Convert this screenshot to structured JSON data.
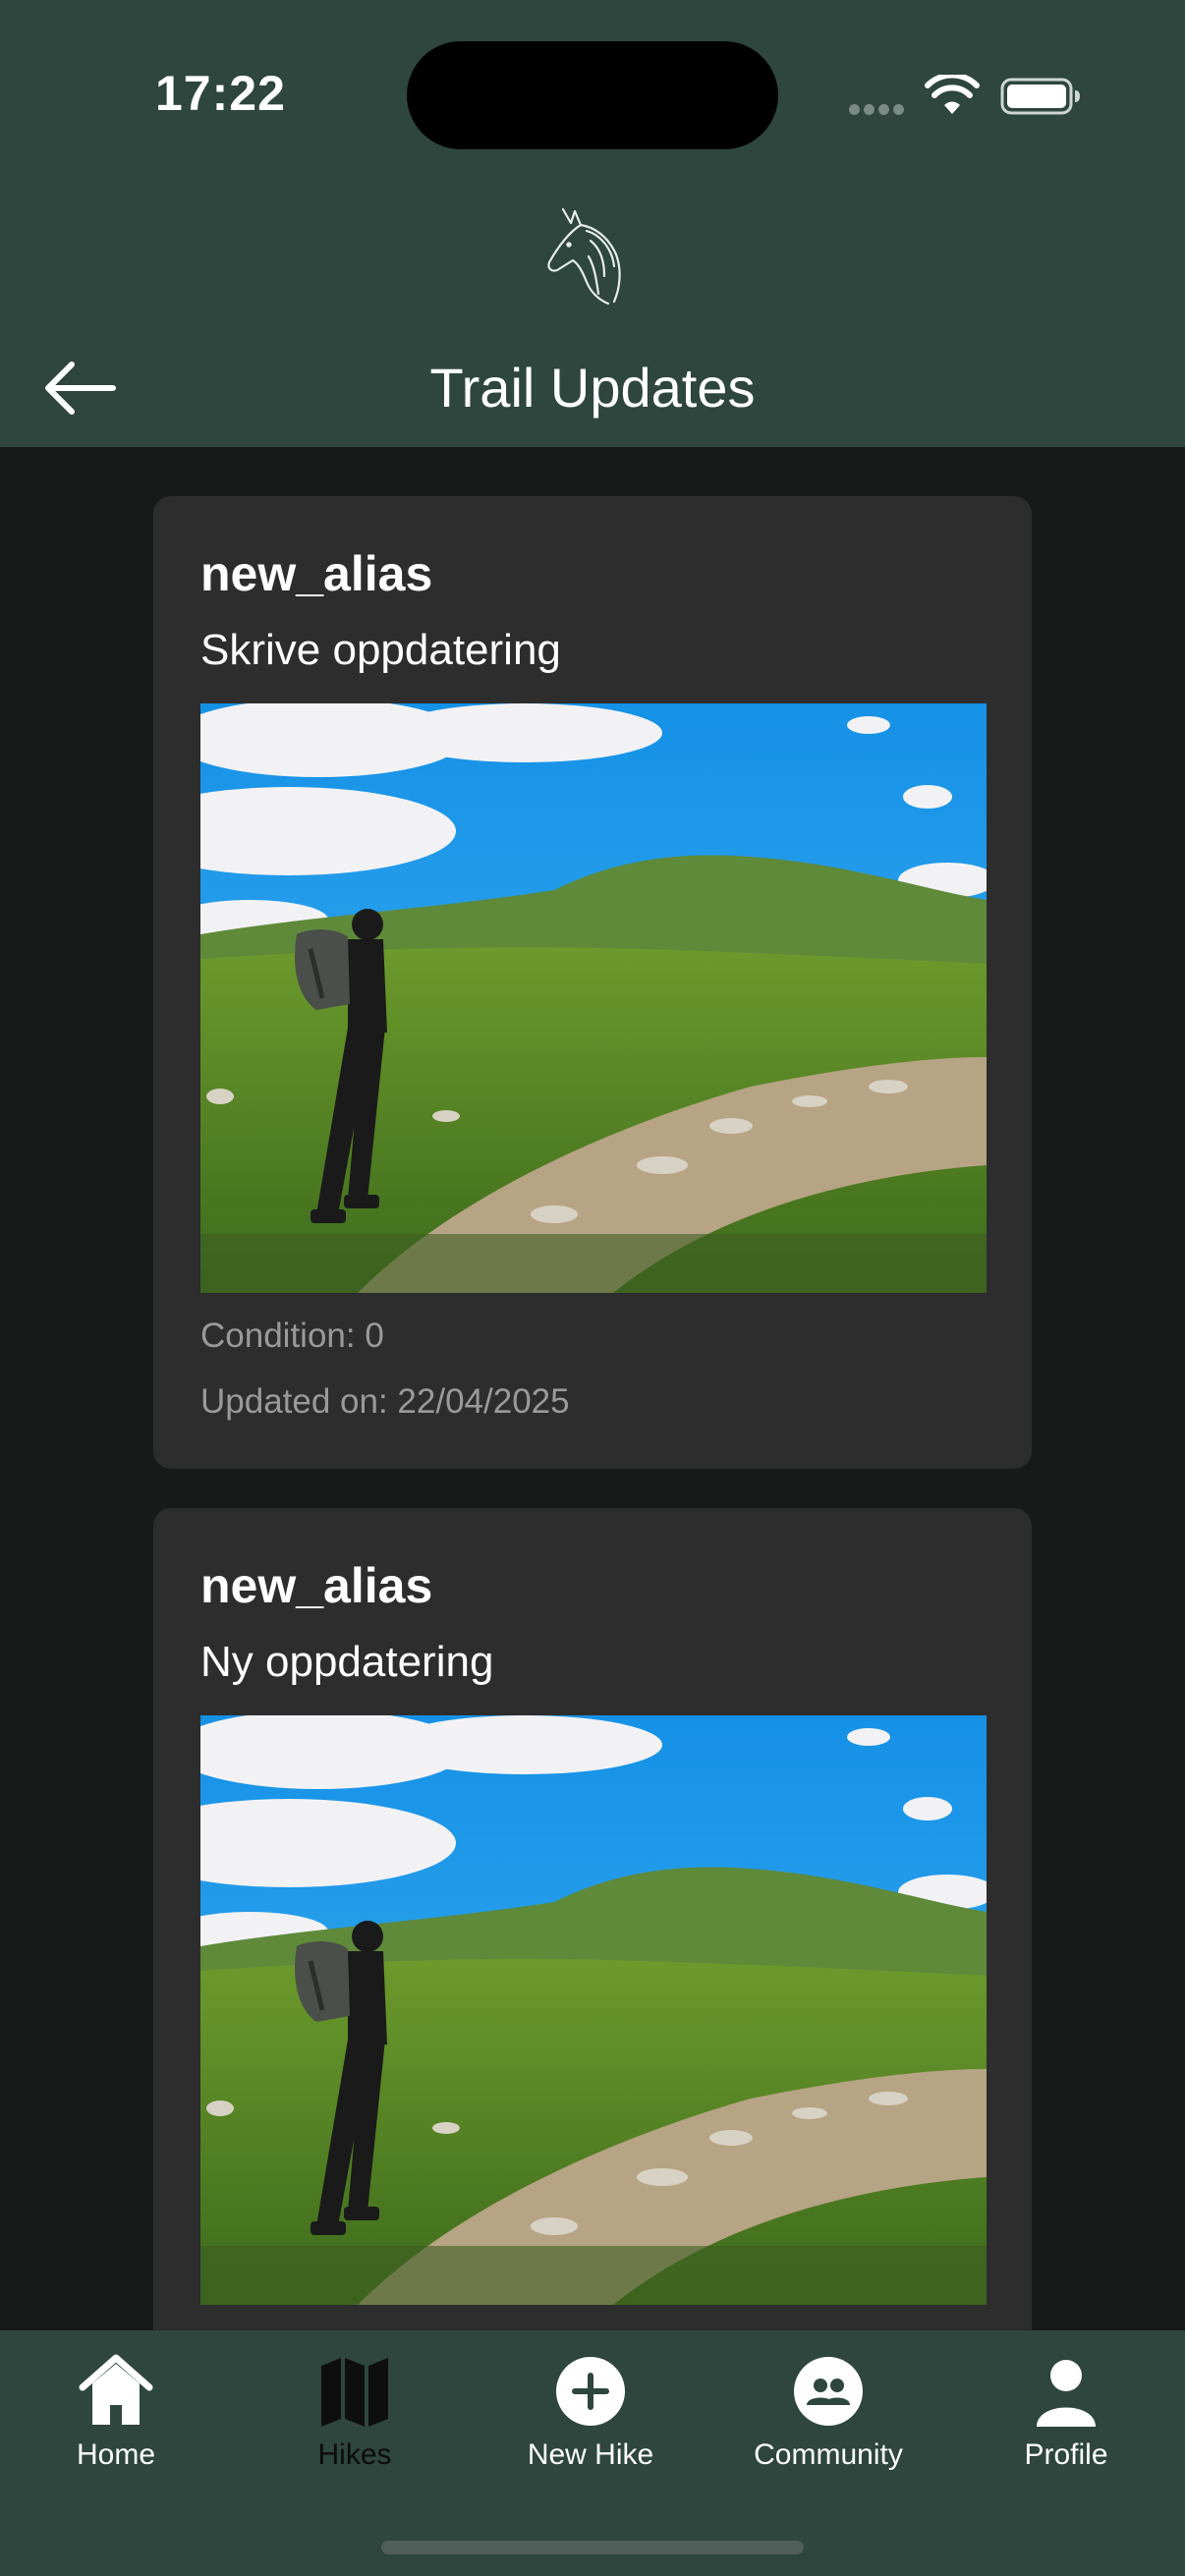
{
  "status_bar": {
    "time": "17:22"
  },
  "header": {
    "logo_icon": "horse-head-icon",
    "back_icon": "arrow-left-icon",
    "title": "Trail Updates"
  },
  "updates": [
    {
      "alias": "new_alias",
      "text": "Skrive oppdatering",
      "image": "hiker-on-mountain-trail",
      "condition": "Condition: 0",
      "updated_on": "Updated on: 22/04/2025"
    },
    {
      "alias": "new_alias",
      "text": "Ny oppdatering",
      "image": "hiker-on-mountain-trail"
    }
  ],
  "bottom_nav": {
    "items": [
      {
        "label": "Home",
        "icon": "home-icon"
      },
      {
        "label": "Hikes",
        "icon": "map-icon"
      },
      {
        "label": "New Hike",
        "icon": "plus-circle-icon"
      },
      {
        "label": "Community",
        "icon": "people-icon"
      },
      {
        "label": "Profile",
        "icon": "person-icon"
      }
    ]
  },
  "colors": {
    "header_bg": "#2e463d",
    "page_bg": "#181a1a",
    "card_bg": "#2d2d2d",
    "meta_text": "#9a9a9a"
  }
}
